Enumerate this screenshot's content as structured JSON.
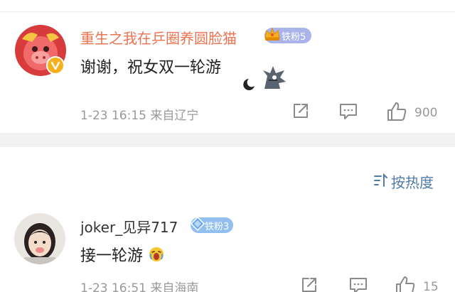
{
  "comments": [
    {
      "username": "重生之我在乒圈养圆脸猫",
      "badge": "铁粉5",
      "text": "谢谢，祝女双一轮游",
      "timestamp": "1-23 16:15",
      "location": "来自辽宁",
      "likes": "900",
      "name_color": "#eb7350"
    },
    {
      "username": "joker_见异717",
      "badge": "铁粉3",
      "text": "接一轮游",
      "timestamp": "1-23 16:51",
      "location": "来自海南",
      "likes": "15",
      "name_color": "#333333"
    }
  ],
  "sort": {
    "label": "按热度"
  },
  "icons": [
    "share-icon",
    "reply-icon",
    "like-icon",
    "sort-icon",
    "crown-icon",
    "diamond-icon",
    "verified-icon",
    "face-emoji-icon"
  ],
  "colors": {
    "accent_link": "#4f7ca8",
    "meta_text": "#999999",
    "badge_purple": "#a9b4ea",
    "badge_blue": "#93bff0"
  }
}
